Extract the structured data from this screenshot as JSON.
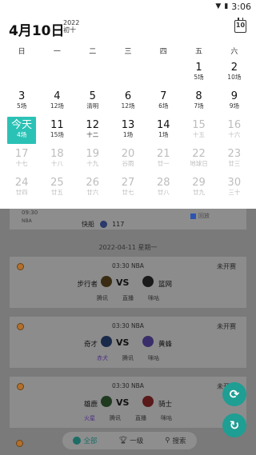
{
  "status_bar": {
    "time": "3:06",
    "wifi_icon": "wifi-icon",
    "battery_icon": "battery-icon"
  },
  "calendar": {
    "title": "4月10日",
    "year": "2022",
    "lunar": "初十",
    "today_icon_label": "10",
    "weekdays": [
      "日",
      "一",
      "二",
      "三",
      "四",
      "五",
      "六"
    ],
    "weeks": [
      [
        {
          "num": "",
          "sub": ""
        },
        {
          "num": "",
          "sub": ""
        },
        {
          "num": "",
          "sub": ""
        },
        {
          "num": "",
          "sub": ""
        },
        {
          "num": "",
          "sub": ""
        },
        {
          "num": "1",
          "sub": "5场"
        },
        {
          "num": "2",
          "sub": "10场"
        }
      ],
      [
        {
          "num": "3",
          "sub": "5场"
        },
        {
          "num": "4",
          "sub": "12场"
        },
        {
          "num": "5",
          "sub": "清明"
        },
        {
          "num": "6",
          "sub": "12场"
        },
        {
          "num": "7",
          "sub": "6场"
        },
        {
          "num": "8",
          "sub": "7场"
        },
        {
          "num": "9",
          "sub": "9场"
        }
      ],
      [
        {
          "num": "今天",
          "sub": "4场",
          "today": true
        },
        {
          "num": "11",
          "sub": "15场"
        },
        {
          "num": "12",
          "sub": "十二"
        },
        {
          "num": "13",
          "sub": "1场"
        },
        {
          "num": "14",
          "sub": "1场"
        },
        {
          "num": "15",
          "sub": "十五",
          "faded": true
        },
        {
          "num": "16",
          "sub": "十六",
          "faded": true
        }
      ],
      [
        {
          "num": "17",
          "sub": "十七",
          "faded": true
        },
        {
          "num": "18",
          "sub": "十八",
          "faded": true
        },
        {
          "num": "19",
          "sub": "十九",
          "faded": true
        },
        {
          "num": "20",
          "sub": "谷雨",
          "faded": true
        },
        {
          "num": "21",
          "sub": "廿一",
          "faded": true
        },
        {
          "num": "22",
          "sub": "地球日",
          "faded": true
        },
        {
          "num": "23",
          "sub": "廿三",
          "faded": true
        }
      ],
      [
        {
          "num": "24",
          "sub": "廿四",
          "faded": true
        },
        {
          "num": "25",
          "sub": "廿五",
          "faded": true
        },
        {
          "num": "26",
          "sub": "廿六",
          "faded": true
        },
        {
          "num": "27",
          "sub": "廿七",
          "faded": true
        },
        {
          "num": "28",
          "sub": "廿八",
          "faded": true
        },
        {
          "num": "29",
          "sub": "廿九",
          "faded": true
        },
        {
          "num": "30",
          "sub": "三十",
          "faded": true
        }
      ]
    ]
  },
  "peek_game": {
    "time": "09:30",
    "league": "NBA",
    "team": "快船",
    "score": "117",
    "replay": "回放"
  },
  "date_divider": "2022-04-11 星期一",
  "games": [
    {
      "time": "03:30 NBA",
      "status": "未开赛",
      "home": "步行者",
      "away": "篮网",
      "vs": "VS",
      "links": [
        "腾讯",
        "直播",
        "咪咕"
      ],
      "logo_left": "#3a2c12",
      "logo_right": "#1a1a1a"
    },
    {
      "time": "03:30 NBA",
      "status": "未开赛",
      "home": "奇才",
      "away": "黄蜂",
      "vs": "VS",
      "links": [
        "赤犬",
        "腾讯",
        "咪咕"
      ],
      "logo_left": "#1a2a4a",
      "logo_right": "#3a2e6a"
    },
    {
      "time": "03:30 NBA",
      "status": "未开赛",
      "home": "雄鹿",
      "away": "骑士",
      "vs": "VS",
      "links": [
        "火星",
        "腾讯",
        "直播",
        "咪咕"
      ],
      "logo_left": "#1f3a1f",
      "logo_right": "#5a1a1a"
    }
  ],
  "bottom_nav": [
    {
      "label": "全部",
      "icon": "ball-icon",
      "active": true
    },
    {
      "label": "一级",
      "icon": "trophy-icon",
      "active": false
    },
    {
      "label": "搜索",
      "icon": "search-icon",
      "active": false
    }
  ],
  "colors": {
    "accent": "#2bc2b6",
    "fab": "#1f9e93"
  }
}
